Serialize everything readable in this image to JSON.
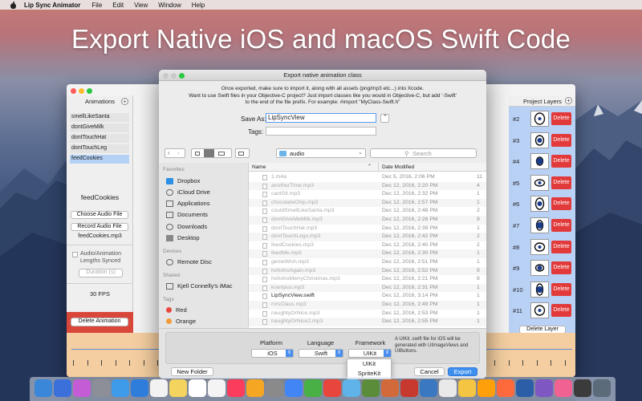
{
  "menubar": {
    "app_name": "Lip Sync Animator",
    "items": [
      "File",
      "Edit",
      "View",
      "Window",
      "Help"
    ]
  },
  "headline": "Export Native iOS and macOS Swift Code",
  "left_panel": {
    "title": "Animations",
    "items": [
      "smellLikeSanta",
      "dontGiveMilk",
      "dontTouchHat",
      "dontTouchLeg",
      "feedCookies"
    ],
    "selected_index": 4,
    "current_name": "feedCookies",
    "choose_audio_label": "Choose Audio File",
    "record_audio_label": "Record Audio File",
    "audio_file": "feedCookies.mp3",
    "sync_label_1": "Audio/Animation",
    "sync_label_2": "Lengths Synced",
    "duration_placeholder": "Duration (s)",
    "fps": "30 FPS",
    "delete_label": "Delete Animation"
  },
  "right_panel": {
    "title": "Project Layers",
    "delete_label": "Delete",
    "layer_numbers": [
      "#2",
      "#3",
      "#4",
      "#5",
      "#6",
      "#7",
      "#8",
      "#9",
      "#10",
      "#11"
    ],
    "delete_layer_label": "Delete Layer"
  },
  "dialog": {
    "title": "Export native animation class",
    "info_lines": [
      "Once exported, make sure to import it, along with all assets (png/mp3 etc...) into Xcode.",
      "Want to use Swift files in your Objective-C project? Just import classes like you would in Objective-C, but add '-Swift'",
      "to the end of the file prefix. For example: #import \"MyClass-Swift.h\""
    ],
    "save_as_label": "Save As:",
    "save_as_value": "LipSyncView",
    "tags_label": "Tags:",
    "folder": "audio",
    "search_placeholder": "Search",
    "sidebar": {
      "favorites_title": "Favorites",
      "favorites": [
        "Dropbox",
        "iCloud Drive",
        "Applications",
        "Documents",
        "Downloads",
        "Desktop"
      ],
      "devices_title": "Devices",
      "devices": [
        "Remote Disc"
      ],
      "shared_title": "Shared",
      "shared": [
        "Kjell Connelly's iMac"
      ],
      "tags_title": "Tags",
      "tags": [
        "Red",
        "Orange"
      ],
      "tag_colors": [
        "#e8483f",
        "#f29a38"
      ]
    },
    "columns": {
      "name": "Name",
      "date": "Date Modified"
    },
    "files": [
      {
        "name": "1.m4a",
        "date": "Dec 5, 2016, 2:06 PM",
        "size": "11"
      },
      {
        "name": "anotherTime.mp3",
        "date": "Dec 12, 2016, 2:20 PM",
        "size": "4"
      },
      {
        "name": "cantSit.mp3",
        "date": "Dec 12, 2016, 2:32 PM",
        "size": "1"
      },
      {
        "name": "chocolateChip.mp3",
        "date": "Dec 12, 2016, 2:57 PM",
        "size": "1"
      },
      {
        "name": "couldSmellLikeSanta.mp3",
        "date": "Dec 12, 2016, 2:48 PM",
        "size": "2"
      },
      {
        "name": "dontGiveMeMilk.mp3",
        "date": "Dec 12, 2016, 2:26 PM",
        "size": "9"
      },
      {
        "name": "dontTouchHat.mp3",
        "date": "Dec 12, 2016, 2:39 PM",
        "size": "1"
      },
      {
        "name": "dontTouchLegs.mp3",
        "date": "Dec 12, 2016, 2:42 PM",
        "size": "2"
      },
      {
        "name": "feedCookies.mp3",
        "date": "Dec 12, 2016, 2:40 PM",
        "size": "2"
      },
      {
        "name": "feedMe.mp3",
        "date": "Dec 12, 2016, 2:30 PM",
        "size": "1"
      },
      {
        "name": "genieWish.mp3",
        "date": "Dec 12, 2016, 2:51 PM",
        "size": "1"
      },
      {
        "name": "hohohoAgain.mp3",
        "date": "Dec 12, 2016, 2:52 PM",
        "size": "9"
      },
      {
        "name": "hohohoMerryChristmas.mp3",
        "date": "Dec 12, 2016, 2:21 PM",
        "size": "8"
      },
      {
        "name": "krampus.mp3",
        "date": "Dec 12, 2016, 2:31 PM",
        "size": "1"
      },
      {
        "name": "LipSyncView.swift",
        "date": "Dec 12, 2016, 3:14 PM",
        "size": "1"
      },
      {
        "name": "mrsClaus.mp3",
        "date": "Dec 12, 2016, 2:49 PM",
        "size": "1"
      },
      {
        "name": "naughtyOrNice.mp3",
        "date": "Dec 12, 2016, 2:53 PM",
        "size": "1"
      },
      {
        "name": "naughtyOrNice2.mp3",
        "date": "Dec 12, 2016, 2:55 PM",
        "size": "1"
      }
    ],
    "platform_label": "Platform",
    "platform_value": "iOS",
    "language_label": "Language",
    "language_value": "Swift",
    "framework_label": "Framework",
    "framework_value": "UIKit",
    "framework_options": [
      "UIKit",
      "SpriteKit"
    ],
    "framework_note_lines": [
      "A UIKit .swift file for iOS will be",
      "generated with UIImageViews and",
      "UIButtons."
    ],
    "new_folder_label": "New Folder",
    "cancel_label": "Cancel",
    "export_label": "Export"
  },
  "dock": {
    "colors": [
      "#3a86d8",
      "#3b6fd9",
      "#c45cd6",
      "#8c8f97",
      "#3d9be9",
      "#2f7ddb",
      "#f2f2f2",
      "#f4d35e",
      "#ffffff",
      "#f4f4f4",
      "#fb3c5c",
      "#f5a623",
      "#8a8a8a",
      "#4285f4",
      "#48b045",
      "#e8453c",
      "#5fb3e8",
      "#5b8c3a",
      "#d2693a",
      "#c7382e",
      "#3a78c2",
      "#e9e9e9",
      "#f4c542",
      "#ff9f0a",
      "#ff6a3d",
      "#2b5ea6",
      "#7e57c2",
      "#f06292",
      "#3b3b3b",
      "#5b6b7a"
    ]
  }
}
